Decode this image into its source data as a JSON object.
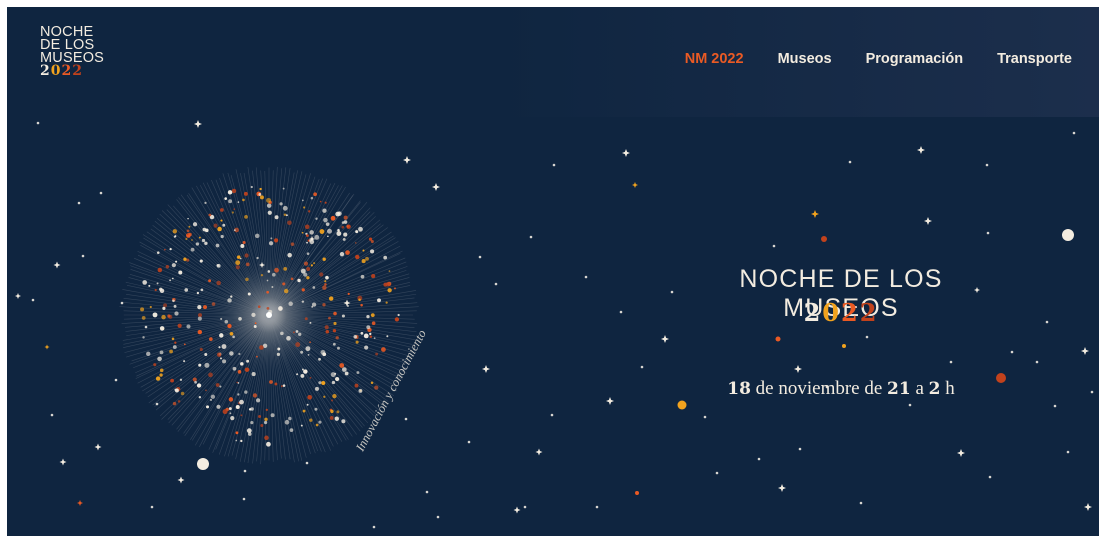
{
  "logo": {
    "line1": "NOCHE",
    "line2": "DE LOS",
    "line3": "MUSEOS",
    "year": "2022"
  },
  "nav": {
    "items": [
      {
        "label": "NM 2022",
        "active": true
      },
      {
        "label": "Museos",
        "active": false
      },
      {
        "label": "Programación",
        "active": false
      },
      {
        "label": "Transporte",
        "active": false
      }
    ]
  },
  "hero": {
    "title": "NOCHE DE LOS MUSEOS",
    "year_digits": [
      "2",
      "0",
      "2",
      "2"
    ],
    "date_day": "18",
    "date_mid": " de noviembre de ",
    "date_start": "21",
    "date_a": " a ",
    "date_end": "2",
    "date_h": " h",
    "tagline": "Innovación y conocimiento"
  },
  "colors": {
    "background": "#0f2540",
    "cream": "#f3ece0",
    "accent_orange": "#ea5a24",
    "accent_yellow": "#f2a31e",
    "accent_rust": "#c2421c"
  }
}
